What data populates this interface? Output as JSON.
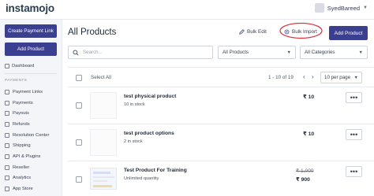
{
  "brand": {
    "logo_text": "instamojo"
  },
  "user": {
    "name": "SyedBareed"
  },
  "sidebar": {
    "create_payment_link": "Create Payment Link",
    "add_product": "Add Product",
    "dashboard": "Dashboard",
    "section_label": "PAYMENTS",
    "items": [
      {
        "label": "Payment Links",
        "icon": "link-icon"
      },
      {
        "label": "Payments",
        "icon": "payments-icon"
      },
      {
        "label": "Payouts",
        "icon": "payouts-icon"
      },
      {
        "label": "Refunds",
        "icon": "refunds-icon"
      },
      {
        "label": "Resolution Center",
        "icon": "resolution-icon"
      },
      {
        "label": "Shipping",
        "icon": "shipping-icon"
      },
      {
        "label": "API & Plugins",
        "icon": "api-icon"
      },
      {
        "label": "Reseller",
        "icon": "reseller-icon"
      },
      {
        "label": "Analytics",
        "icon": "analytics-icon"
      },
      {
        "label": "App Store",
        "icon": "app-store-icon"
      }
    ]
  },
  "main": {
    "title": "All Products",
    "bulk_edit": "Bulk Edit",
    "bulk_import": "Bulk Import",
    "add_product": "Add Product",
    "search_placeholder": "Search...",
    "filter_products": "All Products",
    "filter_categories": "All Categories",
    "select_all": "Select All",
    "range_text": "1 - 10 of 19",
    "per_page": "10 per page"
  },
  "products": [
    {
      "name": "test physical product",
      "sub": "10 in stock",
      "price": "₹ 10"
    },
    {
      "name": "test product options",
      "sub": "2 in stock",
      "price": "₹ 10"
    },
    {
      "name": "Test Product For Training",
      "sub": "Unlimited quantity",
      "old_price": "₹ 1,000",
      "price": "₹ 900"
    }
  ],
  "colors": {
    "accent": "#3b3f8f",
    "annotation": "#e0313b"
  }
}
